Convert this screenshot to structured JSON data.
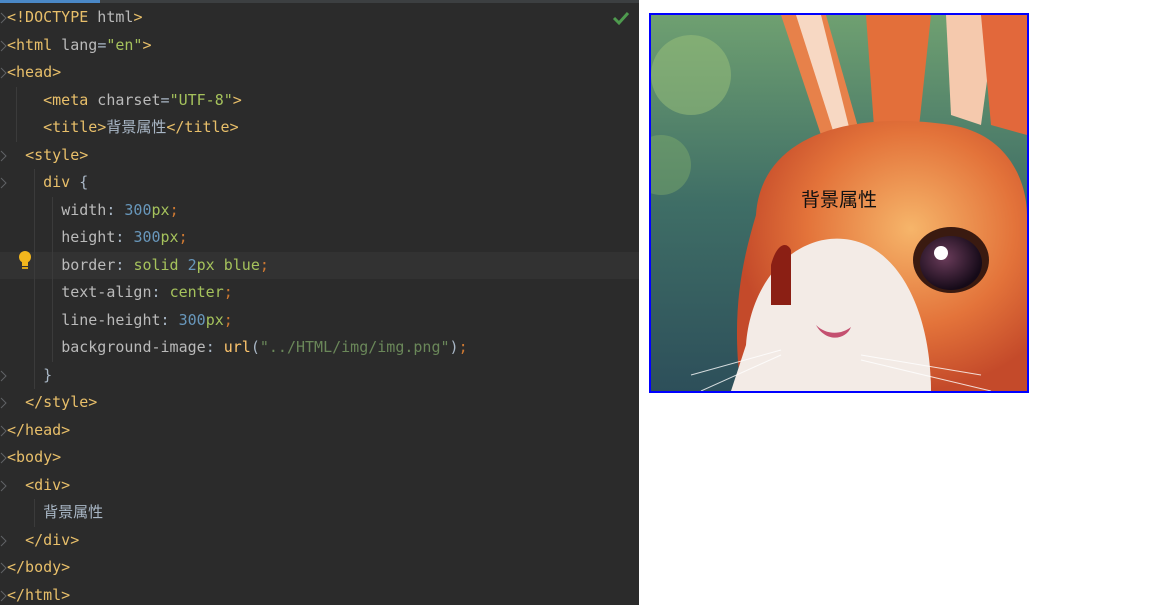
{
  "editor": {
    "lines": [
      [
        [
          "t-tag",
          "<!DOCTYPE"
        ],
        [
          "t-attr",
          " html"
        ],
        [
          "t-tag",
          ">"
        ]
      ],
      [
        [
          "t-tag",
          "<html"
        ],
        [
          "t-attr",
          " lang"
        ],
        [
          "t-plain",
          "="
        ],
        [
          "t-str",
          "\"en\""
        ],
        [
          "t-tag",
          ">"
        ]
      ],
      [
        [
          "t-tag",
          "<head>"
        ]
      ],
      [
        [
          "t-plain",
          "    "
        ],
        [
          "t-tag",
          "<meta"
        ],
        [
          "t-attr",
          " charset"
        ],
        [
          "t-plain",
          "="
        ],
        [
          "t-str",
          "\"UTF-8\""
        ],
        [
          "t-tag",
          ">"
        ]
      ],
      [
        [
          "t-plain",
          "    "
        ],
        [
          "t-tag",
          "<title>"
        ],
        [
          "t-plain",
          "背景属性"
        ],
        [
          "t-tag",
          "</title>"
        ]
      ],
      [
        [
          "t-plain",
          "  "
        ],
        [
          "t-tag",
          "<style>"
        ]
      ],
      [
        [
          "t-plain",
          "    "
        ],
        [
          "t-sel",
          "div"
        ],
        [
          "t-plain",
          " {"
        ]
      ],
      [
        [
          "t-plain",
          "      "
        ],
        [
          "t-prop",
          "width"
        ],
        [
          "t-plain",
          ": "
        ],
        [
          "t-num",
          "300"
        ],
        [
          "t-kw",
          "px"
        ],
        [
          "t-punc",
          ";"
        ]
      ],
      [
        [
          "t-plain",
          "      "
        ],
        [
          "t-prop",
          "height"
        ],
        [
          "t-plain",
          ": "
        ],
        [
          "t-num",
          "300"
        ],
        [
          "t-kw",
          "px"
        ],
        [
          "t-punc",
          ";"
        ]
      ],
      [
        [
          "t-plain",
          "      "
        ],
        [
          "t-prop",
          "border"
        ],
        [
          "t-plain",
          ": "
        ],
        [
          "t-kw",
          "solid "
        ],
        [
          "t-num",
          "2"
        ],
        [
          "t-kw",
          "px blue"
        ],
        [
          "t-punc",
          ";"
        ]
      ],
      [
        [
          "t-plain",
          "      "
        ],
        [
          "t-prop",
          "text-align"
        ],
        [
          "t-plain",
          ": "
        ],
        [
          "t-kw",
          "center"
        ],
        [
          "t-punc",
          ";"
        ]
      ],
      [
        [
          "t-plain",
          "      "
        ],
        [
          "t-prop",
          "line-height"
        ],
        [
          "t-plain",
          ": "
        ],
        [
          "t-num",
          "300"
        ],
        [
          "t-kw",
          "px"
        ],
        [
          "t-punc",
          ";"
        ]
      ],
      [
        [
          "t-plain",
          "      "
        ],
        [
          "t-prop",
          "background-image"
        ],
        [
          "t-plain",
          ": "
        ],
        [
          "t-fn",
          "url"
        ],
        [
          "t-plain",
          "("
        ],
        [
          "t-url",
          "\"../HTML/img/img.png\""
        ],
        [
          "t-plain",
          ")"
        ],
        [
          "t-punc",
          ";"
        ]
      ],
      [
        [
          "t-plain",
          "    }"
        ]
      ],
      [
        [
          "t-plain",
          "  "
        ],
        [
          "t-tag",
          "</style>"
        ]
      ],
      [
        [
          "t-tag",
          "</head>"
        ]
      ],
      [
        [
          "t-tag",
          "<body>"
        ]
      ],
      [
        [
          "t-plain",
          "  "
        ],
        [
          "t-tag",
          "<div>"
        ]
      ],
      [
        [
          "t-plain",
          "    背景属性"
        ]
      ],
      [
        [
          "t-plain",
          "  "
        ],
        [
          "t-tag",
          "</div>"
        ]
      ],
      [
        [
          "t-tag",
          "</body>"
        ]
      ],
      [
        [
          "t-tag",
          "</html>"
        ]
      ]
    ],
    "highlighted_line": 9,
    "status_icon": "check-icon",
    "intention_icon": "lightbulb-icon",
    "colors": {
      "background": "#2b2b2b",
      "tag": "#e8bf6a",
      "string": "#a5c25c",
      "number": "#6897bb",
      "punctuation": "#cc7832"
    }
  },
  "preview": {
    "div_text": "背景属性",
    "border_color": "#0000ff",
    "background_image": "rabbit-illustration"
  }
}
